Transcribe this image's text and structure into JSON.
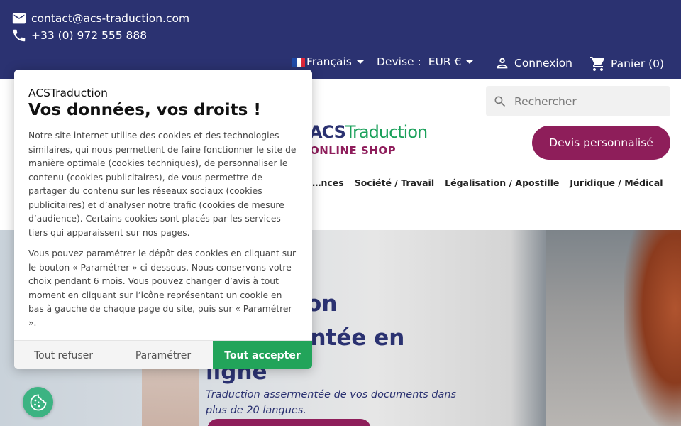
{
  "topbar": {
    "email": "contact@acs-traduction.com",
    "phone": "+33 (0) 972 555 888",
    "language": "Français",
    "currency_label": "Devise :",
    "currency_value": "EUR €",
    "login": "Connexion",
    "cart": "Panier (0)"
  },
  "header": {
    "search_placeholder": "Rechercher",
    "logo_acs": "ACS",
    "logo_traduction": "Traduction",
    "logo_sub": "ONLINE SHOP",
    "quote_button": "Devis personnalisé",
    "menu": [
      "…nces",
      "Société / Travail",
      "Légalisation / Apostille",
      "Juridique / Médical"
    ]
  },
  "hero": {
    "title": "Traduction assermentée en ligne",
    "subtitle": "Traduction assermentée de vos documents dans plus de 20 langues."
  },
  "cookie": {
    "brand": "ACSTraduction",
    "title": "Vos données, vos droits !",
    "paragraph1": "Notre site internet utilise des cookies et des technologies similaires, qui nous permettent de faire fonctionner le site de manière optimale (cookies techniques), de personnaliser le contenu (cookies publicitaires), de vous permettre de partager du contenu sur les réseaux sociaux (cookies publicitaires) et d’analyser notre trafic (cookies de mesure d’audience). Certains cookies sont placés par les services tiers qui apparaissent sur nos pages.",
    "paragraph2": "Vous pouvez paramétrer le dépôt des cookies en cliquant sur le bouton « Paramétrer » ci-dessous. Nous conservons votre choix pendant 6 mois. Vous pouvez changer d’avis à tout moment en cliquant sur l’icône représentant un cookie en bas à gauche de chaque page du site, puis sur « Paramétrer ».",
    "refuse": "Tout refuser",
    "settings": "Paramétrer",
    "accept": "Tout accepter"
  },
  "colors": {
    "topbar": "#2b3271",
    "brand_purple": "#8e1e5a",
    "accept_green": "#22a45a",
    "fab_green": "#3cb382"
  },
  "icons": [
    "mail-icon",
    "phone-icon",
    "flag-fr-icon",
    "user-icon",
    "cart-icon",
    "search-icon",
    "cookie-icon"
  ]
}
